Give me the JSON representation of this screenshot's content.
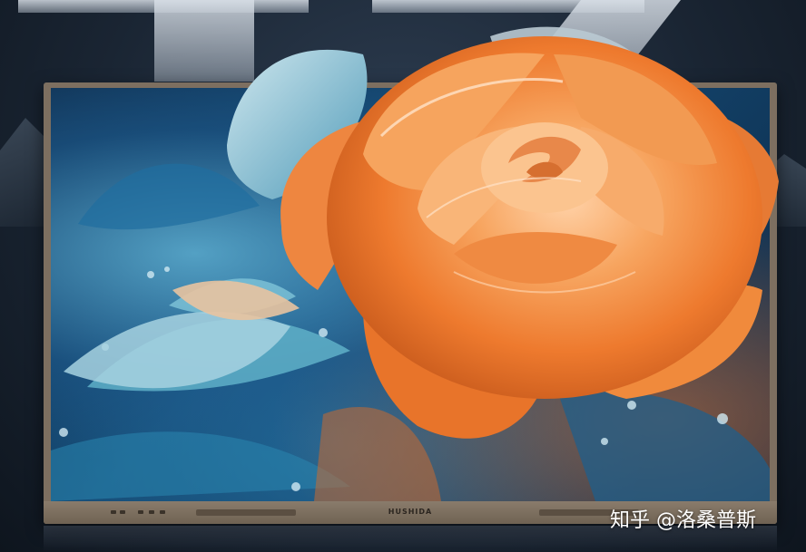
{
  "product": {
    "brand_label": "HUSHIDA"
  },
  "watermark": {
    "text": "知乎 @洛桑普斯"
  },
  "colors": {
    "bezel": "#7d6f60",
    "rose_orange": "#f08a3c",
    "background_blue": "#154a74"
  }
}
